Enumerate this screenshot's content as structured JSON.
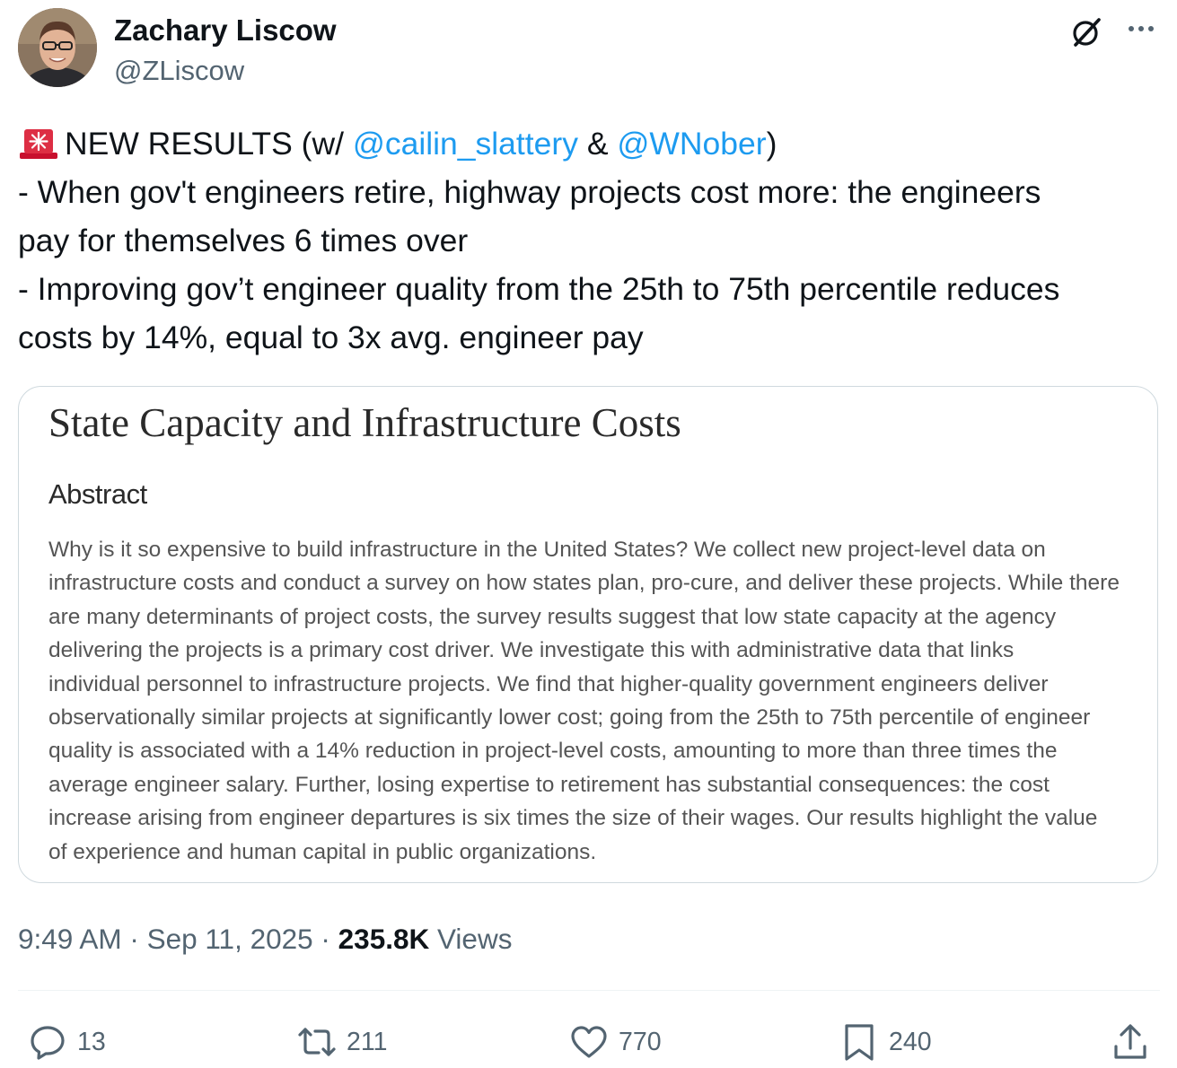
{
  "author": {
    "display_name": "Zachary Liscow",
    "handle": "@ZLiscow"
  },
  "header_icons": [
    "grok-icon",
    "more-icon"
  ],
  "tweet": {
    "line1": {
      "emoji": "🚨",
      "prefix": "NEW RESULTS (w/ ",
      "mention1": "@cailin_slattery",
      "middle": " & ",
      "mention2": "@WNober",
      "suffix": ")"
    },
    "line2": "- When gov't engineers retire, highway projects cost more: the engineers",
    "line3": "pay for themselves 6 times over",
    "line4": "- Improving gov’t engineer quality from the 25th to 75th percentile reduces",
    "line5": "costs by 14%, equal to 3x avg. engineer pay"
  },
  "card": {
    "title": "State Capacity and Infrastructure Costs",
    "abstract_heading": "Abstract",
    "abstract_lines": [
      "Why is it so expensive to build infrastructure in the United States? We collect new project-level data on",
      "infrastructure costs and conduct a survey on how states plan, pro-cure, and deliver these projects. While there",
      "are many determinants of project costs, the survey results suggest that low state capacity at the agency",
      "delivering the projects is a primary cost driver. We investigate this with administrative data that links",
      "individual personnel to infrastructure projects. We find that higher-quality government engineers deliver",
      "observationally similar projects at significantly lower cost; going from the 25th to 75th percentile of engineer",
      "quality is associated with a 14% reduction in project-level costs, amounting to more than three times the",
      "average engineer salary. Further, losing expertise to retirement has substantial consequences: the cost",
      "increase arising from engineer departures is six times the size of their wages. Our results highlight the value",
      "of experience and human capital in public organizations."
    ]
  },
  "meta": {
    "time": "9:49 AM",
    "separator": " · ",
    "date": "Sep 11, 2025",
    "views_count": "235.8K",
    "views_label": " Views"
  },
  "actions": {
    "reply_count": "13",
    "retweet_count": "211",
    "like_count": "770",
    "bookmark_count": "240"
  },
  "colors": {
    "text": "#0f1419",
    "secondary": "#536471",
    "link": "#1d9bf0",
    "border": "#cfd9de"
  }
}
